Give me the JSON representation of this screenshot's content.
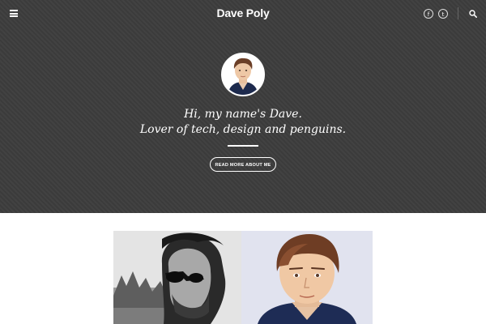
{
  "header": {
    "site_title": "Dave Poly",
    "menu_icon": "hamburger-menu-icon",
    "social_links": [
      {
        "name": "facebook",
        "glyph": "f",
        "icon": "facebook-icon"
      },
      {
        "name": "twitter",
        "glyph": "t",
        "icon": "twitter-icon"
      }
    ],
    "search_icon": "search-icon"
  },
  "hero": {
    "tagline_line1": "Hi, my name's Dave.",
    "tagline_line2": "Lover of tech, design and penguins.",
    "cta_label": "READ MORE ABOUT ME",
    "background_color": "#3d3d3d"
  },
  "gallery": {
    "images": [
      {
        "name": "black-and-white-photo-of-dave"
      },
      {
        "name": "cartoon-portrait-of-dave"
      }
    ]
  }
}
